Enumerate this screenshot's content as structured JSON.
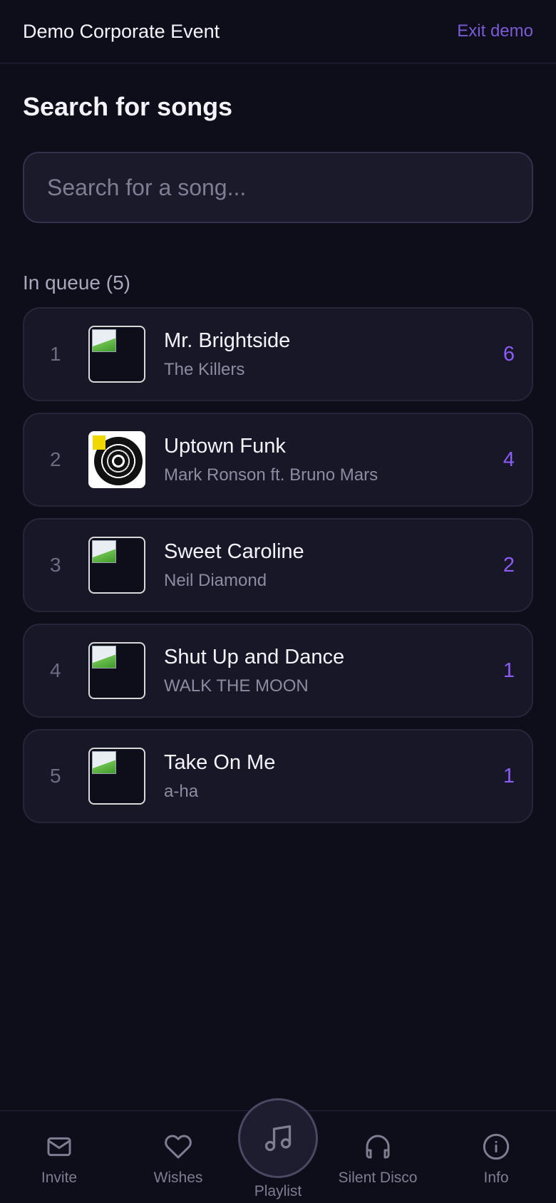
{
  "header": {
    "event_title": "Demo Corporate Event",
    "exit_label": "Exit demo"
  },
  "search": {
    "title": "Search for songs",
    "placeholder": "Search for a song..."
  },
  "queue": {
    "heading": "In queue (5)",
    "items": [
      {
        "position": "1",
        "song": "Mr. Brightside",
        "artist": "The Killers",
        "votes": "6",
        "cover": "broken"
      },
      {
        "position": "2",
        "song": "Uptown Funk",
        "artist": "Mark Ronson ft. Bruno Mars",
        "votes": "4",
        "cover": "vinyl"
      },
      {
        "position": "3",
        "song": "Sweet Caroline",
        "artist": "Neil Diamond",
        "votes": "2",
        "cover": "broken"
      },
      {
        "position": "4",
        "song": "Shut Up and Dance",
        "artist": "WALK THE MOON",
        "votes": "1",
        "cover": "broken"
      },
      {
        "position": "5",
        "song": "Take On Me",
        "artist": "a-ha",
        "votes": "1",
        "cover": "broken"
      }
    ]
  },
  "nav": {
    "invite": "Invite",
    "wishes": "Wishes",
    "playlist": "Playlist",
    "silent_disco": "Silent Disco",
    "info": "Info"
  },
  "colors": {
    "accent": "#8b5cf6",
    "background": "#0e0d1a",
    "card": "#181727"
  }
}
